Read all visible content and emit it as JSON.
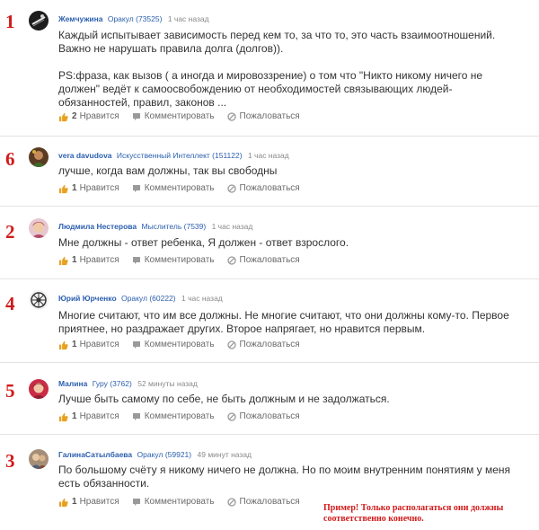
{
  "labels": {
    "like": "Нравится",
    "comment": "Комментировать",
    "complain": "Пожаловаться"
  },
  "answers": [
    {
      "rank": "1",
      "name": "Жемчужина",
      "title": "Оракул",
      "score": "(73525)",
      "time": "1 час назад",
      "likes": "2",
      "text": [
        "Каждый испытывает зависимость перед кем то, за что то, это часть взаимоотношений. Важно не нарушать правила долга (долгов)).",
        "PS:фраза, как вызов ( а иногда и мировоззрение) о том что \"Никто никому ничего не должен\" ведёт к самоосвобождению от необходимостей связывающих людей- обязанностей, правил, законов ..."
      ]
    },
    {
      "rank": "6",
      "name": "vera davudova",
      "title": "Искусственный Интеллект",
      "score": "(151122)",
      "time": "1 час назад",
      "likes": "1",
      "text": [
        "лучше, когда вам должны, так вы свободны"
      ]
    },
    {
      "rank": "2",
      "name": "Людмила Нестерова",
      "title": "Мыслитель",
      "score": "(7539)",
      "time": "1 час назад",
      "likes": "1",
      "text": [
        "Мне должны - ответ ребенка, Я должен - ответ взрослого."
      ]
    },
    {
      "rank": "4",
      "name": "Юрий Юрченко",
      "title": "Оракул",
      "score": "(60222)",
      "time": "1 час назад",
      "likes": "1",
      "text": [
        "Многие считают, что им все должны. Не многие считают, что они должны кому-то. Первое приятнее, но раздражает других. Второе напрягает, но нравится первым."
      ]
    },
    {
      "rank": "5",
      "name": "Малина",
      "title": "Гуру",
      "score": "(3762)",
      "time": "52 минуты назад",
      "likes": "1",
      "text": [
        "Лучше быть самому по себе, не быть должным и не задолжаться."
      ]
    },
    {
      "rank": "3",
      "name": "ГалинаСатылбаева",
      "title": "Оракул",
      "score": "(59921)",
      "time": "49 минут назад",
      "likes": "1",
      "text": [
        "По большому счёту я никому ничего не должна. Но по моим внутренним понятиям у меня есть обязанности."
      ]
    }
  ],
  "note": "Пример! Только располагаться они должны соответственно конечно.",
  "colors": {
    "link": "#2b5fae",
    "rank": "#d11a1a",
    "like_thumb": "#e8a11f",
    "muted": "#8a8a8a"
  }
}
